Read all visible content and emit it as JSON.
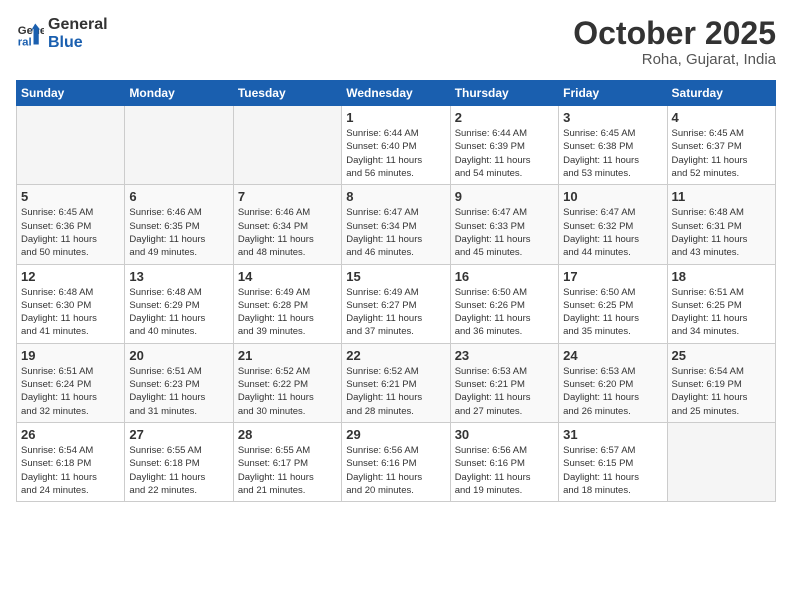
{
  "logo": {
    "line1": "General",
    "line2": "Blue"
  },
  "title": "October 2025",
  "subtitle": "Roha, Gujarat, India",
  "weekdays": [
    "Sunday",
    "Monday",
    "Tuesday",
    "Wednesday",
    "Thursday",
    "Friday",
    "Saturday"
  ],
  "weeks": [
    [
      {
        "day": "",
        "info": ""
      },
      {
        "day": "",
        "info": ""
      },
      {
        "day": "",
        "info": ""
      },
      {
        "day": "1",
        "info": "Sunrise: 6:44 AM\nSunset: 6:40 PM\nDaylight: 11 hours\nand 56 minutes."
      },
      {
        "day": "2",
        "info": "Sunrise: 6:44 AM\nSunset: 6:39 PM\nDaylight: 11 hours\nand 54 minutes."
      },
      {
        "day": "3",
        "info": "Sunrise: 6:45 AM\nSunset: 6:38 PM\nDaylight: 11 hours\nand 53 minutes."
      },
      {
        "day": "4",
        "info": "Sunrise: 6:45 AM\nSunset: 6:37 PM\nDaylight: 11 hours\nand 52 minutes."
      }
    ],
    [
      {
        "day": "5",
        "info": "Sunrise: 6:45 AM\nSunset: 6:36 PM\nDaylight: 11 hours\nand 50 minutes."
      },
      {
        "day": "6",
        "info": "Sunrise: 6:46 AM\nSunset: 6:35 PM\nDaylight: 11 hours\nand 49 minutes."
      },
      {
        "day": "7",
        "info": "Sunrise: 6:46 AM\nSunset: 6:34 PM\nDaylight: 11 hours\nand 48 minutes."
      },
      {
        "day": "8",
        "info": "Sunrise: 6:47 AM\nSunset: 6:34 PM\nDaylight: 11 hours\nand 46 minutes."
      },
      {
        "day": "9",
        "info": "Sunrise: 6:47 AM\nSunset: 6:33 PM\nDaylight: 11 hours\nand 45 minutes."
      },
      {
        "day": "10",
        "info": "Sunrise: 6:47 AM\nSunset: 6:32 PM\nDaylight: 11 hours\nand 44 minutes."
      },
      {
        "day": "11",
        "info": "Sunrise: 6:48 AM\nSunset: 6:31 PM\nDaylight: 11 hours\nand 43 minutes."
      }
    ],
    [
      {
        "day": "12",
        "info": "Sunrise: 6:48 AM\nSunset: 6:30 PM\nDaylight: 11 hours\nand 41 minutes."
      },
      {
        "day": "13",
        "info": "Sunrise: 6:48 AM\nSunset: 6:29 PM\nDaylight: 11 hours\nand 40 minutes."
      },
      {
        "day": "14",
        "info": "Sunrise: 6:49 AM\nSunset: 6:28 PM\nDaylight: 11 hours\nand 39 minutes."
      },
      {
        "day": "15",
        "info": "Sunrise: 6:49 AM\nSunset: 6:27 PM\nDaylight: 11 hours\nand 37 minutes."
      },
      {
        "day": "16",
        "info": "Sunrise: 6:50 AM\nSunset: 6:26 PM\nDaylight: 11 hours\nand 36 minutes."
      },
      {
        "day": "17",
        "info": "Sunrise: 6:50 AM\nSunset: 6:25 PM\nDaylight: 11 hours\nand 35 minutes."
      },
      {
        "day": "18",
        "info": "Sunrise: 6:51 AM\nSunset: 6:25 PM\nDaylight: 11 hours\nand 34 minutes."
      }
    ],
    [
      {
        "day": "19",
        "info": "Sunrise: 6:51 AM\nSunset: 6:24 PM\nDaylight: 11 hours\nand 32 minutes."
      },
      {
        "day": "20",
        "info": "Sunrise: 6:51 AM\nSunset: 6:23 PM\nDaylight: 11 hours\nand 31 minutes."
      },
      {
        "day": "21",
        "info": "Sunrise: 6:52 AM\nSunset: 6:22 PM\nDaylight: 11 hours\nand 30 minutes."
      },
      {
        "day": "22",
        "info": "Sunrise: 6:52 AM\nSunset: 6:21 PM\nDaylight: 11 hours\nand 28 minutes."
      },
      {
        "day": "23",
        "info": "Sunrise: 6:53 AM\nSunset: 6:21 PM\nDaylight: 11 hours\nand 27 minutes."
      },
      {
        "day": "24",
        "info": "Sunrise: 6:53 AM\nSunset: 6:20 PM\nDaylight: 11 hours\nand 26 minutes."
      },
      {
        "day": "25",
        "info": "Sunrise: 6:54 AM\nSunset: 6:19 PM\nDaylight: 11 hours\nand 25 minutes."
      }
    ],
    [
      {
        "day": "26",
        "info": "Sunrise: 6:54 AM\nSunset: 6:18 PM\nDaylight: 11 hours\nand 24 minutes."
      },
      {
        "day": "27",
        "info": "Sunrise: 6:55 AM\nSunset: 6:18 PM\nDaylight: 11 hours\nand 22 minutes."
      },
      {
        "day": "28",
        "info": "Sunrise: 6:55 AM\nSunset: 6:17 PM\nDaylight: 11 hours\nand 21 minutes."
      },
      {
        "day": "29",
        "info": "Sunrise: 6:56 AM\nSunset: 6:16 PM\nDaylight: 11 hours\nand 20 minutes."
      },
      {
        "day": "30",
        "info": "Sunrise: 6:56 AM\nSunset: 6:16 PM\nDaylight: 11 hours\nand 19 minutes."
      },
      {
        "day": "31",
        "info": "Sunrise: 6:57 AM\nSunset: 6:15 PM\nDaylight: 11 hours\nand 18 minutes."
      },
      {
        "day": "",
        "info": ""
      }
    ]
  ]
}
